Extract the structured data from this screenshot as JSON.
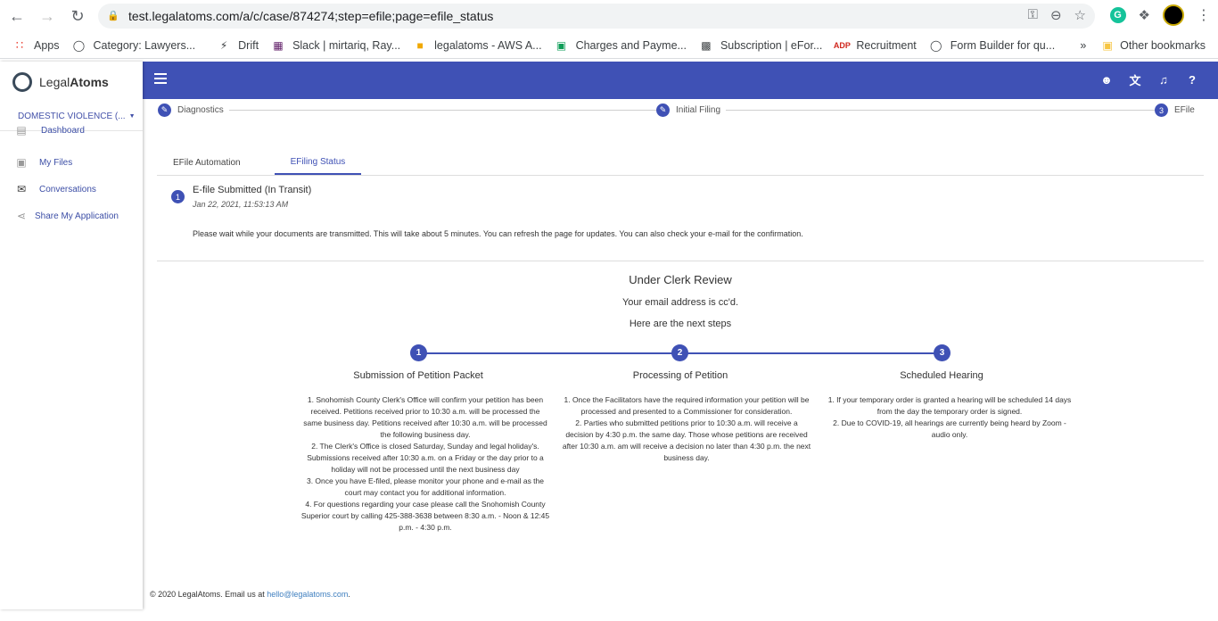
{
  "browser": {
    "url": "test.legalatoms.com/a/c/case/874274;step=efile;page=efile_status",
    "bookmarks": [
      {
        "label": "Apps",
        "icon": "apps-grid-icon"
      },
      {
        "label": "Category: Lawyers...",
        "icon": "site-icon"
      },
      {
        "label": "Drift",
        "icon": "drift-icon"
      },
      {
        "label": "Slack | mirtariq, Ray...",
        "icon": "slack-icon"
      },
      {
        "label": "legalatoms - AWS A...",
        "icon": "aws-icon"
      },
      {
        "label": "Charges and Payme...",
        "icon": "sheets-icon"
      },
      {
        "label": "Subscription | eFor...",
        "icon": "doc-icon"
      },
      {
        "label": "Recruitment",
        "icon": "adp-icon"
      },
      {
        "label": "Form Builder for qu...",
        "icon": "site-icon"
      }
    ],
    "more_bookmarks": "»",
    "other_bookmarks": "Other bookmarks",
    "extension_g": "G"
  },
  "app": {
    "logo_light": "Legal",
    "logo_bold": "Atoms",
    "case_select": "DOMESTIC VIOLENCE (...",
    "sidebar": [
      {
        "label": "Dashboard",
        "icon": "dashboard-icon"
      },
      {
        "label": "My Files",
        "icon": "folder-icon"
      },
      {
        "label": "Conversations",
        "icon": "chat-icon"
      },
      {
        "label": "Share My Application",
        "icon": "share-icon"
      }
    ],
    "top_icons": [
      "account-icon",
      "translate-icon",
      "bell-icon",
      "help-icon"
    ]
  },
  "stepper": {
    "steps": [
      {
        "label": "Diagnostics",
        "marker": "edit"
      },
      {
        "label": "Initial Filing",
        "marker": "edit"
      },
      {
        "label": "EFile",
        "marker": "3"
      }
    ]
  },
  "tabs": [
    {
      "label": "EFile Automation",
      "active": false
    },
    {
      "label": "EFiling Status",
      "active": true
    }
  ],
  "status": {
    "number": "1",
    "title": "E-file Submitted (In Transit)",
    "time": "Jan 22, 2021, 11:53:13 AM",
    "message": "Please wait while your documents are transmitted. This will take about 5 minutes. You can refresh the page for updates. You can also check your e-mail for the confirmation."
  },
  "review": {
    "title": "Under Clerk Review",
    "cc": "Your email address is cc'd.",
    "next": "Here are the next steps",
    "columns": [
      {
        "number": "1",
        "title": "Submission of Petition Packet",
        "items": [
          "1.   Snohomish County Clerk's Office will confirm your petition has been received. Petitions received prior to 10:30 a.m. will be processed the same business day. Petitions received after 10:30 a.m. will be processed the following business day.",
          "2.   The Clerk's Office is closed Saturday, Sunday and legal holiday's. Submissions received after 10:30 a.m. on a Friday or the day prior to a holiday will not be processed until the next business day",
          "3.   Once you have E-filed, please monitor your phone and e-mail as the court may contact you for additional information.",
          "4.      For questions regarding your case please call the Snohomish County Superior court by calling 425-388-3638 between 8:30 a.m. - Noon & 12:45 p.m. - 4:30 p.m."
        ]
      },
      {
        "number": "2",
        "title": "Processing of Petition",
        "items": [
          "1.  Once the Facilitators have the required information your petition will be processed and presented to a Commissioner for consideration.",
          "2.  Parties who submitted petitions prior to 10:30 a.m. will receive a decision by 4:30 p.m. the same day. Those whose petitions are received after 10:30 a.m. am will receive a decision no later than 4:30 p.m. the next business day."
        ]
      },
      {
        "number": "3",
        "title": "Scheduled Hearing",
        "items": [
          "1.  If your temporary order is granted a hearing will be scheduled 14 days from the day the temporary order is signed.",
          "2.  Due to COVID-19, all hearings are currently being heard by Zoom - audio only."
        ]
      }
    ]
  },
  "footer": {
    "text": "© 2020 LegalAtoms.  Email us at ",
    "email": "hello@legalatoms.com",
    "period": "."
  }
}
